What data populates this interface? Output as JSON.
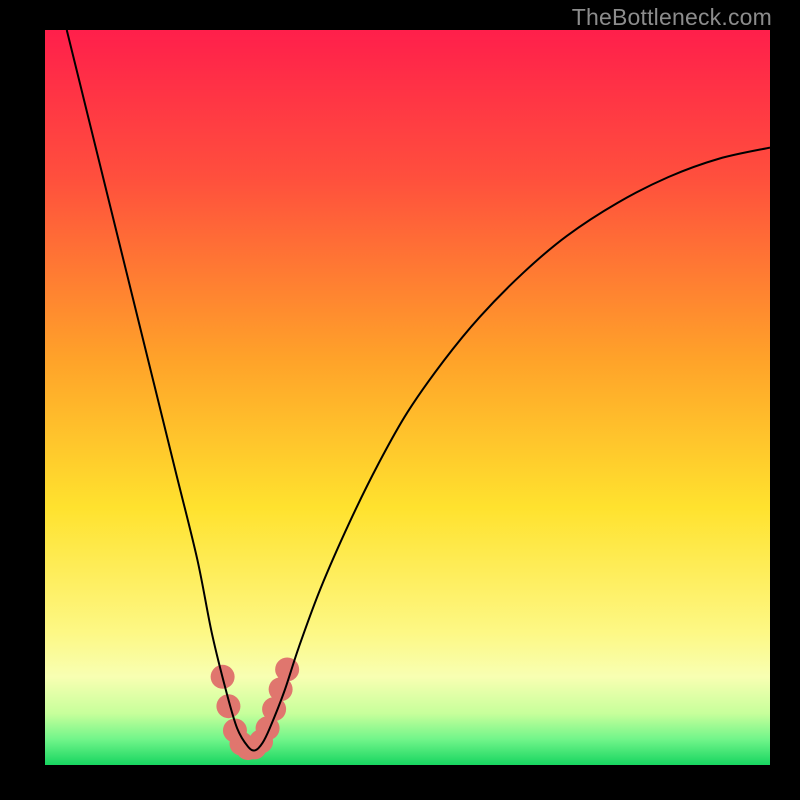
{
  "watermark": "TheBottleneck.com",
  "chart_data": {
    "type": "line",
    "title": "",
    "xlabel": "",
    "ylabel": "",
    "xlim": [
      0,
      100
    ],
    "ylim": [
      0,
      100
    ],
    "gradient_stops": [
      {
        "offset": 0.0,
        "color": "#ff1f4b"
      },
      {
        "offset": 0.2,
        "color": "#ff4f3d"
      },
      {
        "offset": 0.45,
        "color": "#ffa329"
      },
      {
        "offset": 0.65,
        "color": "#ffe22e"
      },
      {
        "offset": 0.82,
        "color": "#fdf885"
      },
      {
        "offset": 0.88,
        "color": "#f8ffb2"
      },
      {
        "offset": 0.93,
        "color": "#c7ff9b"
      },
      {
        "offset": 0.965,
        "color": "#71f58a"
      },
      {
        "offset": 1.0,
        "color": "#17d560"
      }
    ],
    "series": [
      {
        "name": "bottleneck-curve",
        "x": [
          3,
          6,
          9,
          12,
          15,
          18,
          21,
          23,
          25,
          26.5,
          28,
          29,
          30,
          31,
          33,
          35,
          38,
          42,
          46,
          50,
          55,
          60,
          66,
          72,
          79,
          86,
          93,
          100
        ],
        "y": [
          100,
          88,
          76,
          64,
          52,
          40,
          28,
          18,
          10,
          5,
          2.5,
          2,
          3,
          5,
          10,
          16,
          24,
          33,
          41,
          48,
          55,
          61,
          67,
          72,
          76.5,
          80,
          82.5,
          84
        ]
      }
    ],
    "marker_band": {
      "name": "optimal-band",
      "x": [
        24.5,
        25.3,
        26.2,
        27.1,
        28.0,
        28.9,
        29.8,
        30.7,
        31.6,
        32.5,
        33.4
      ],
      "y": [
        12.0,
        8.0,
        4.7,
        2.9,
        2.3,
        2.4,
        3.2,
        5.0,
        7.6,
        10.3,
        13.0
      ],
      "color": "#e0766e",
      "radius_px": 12
    }
  }
}
